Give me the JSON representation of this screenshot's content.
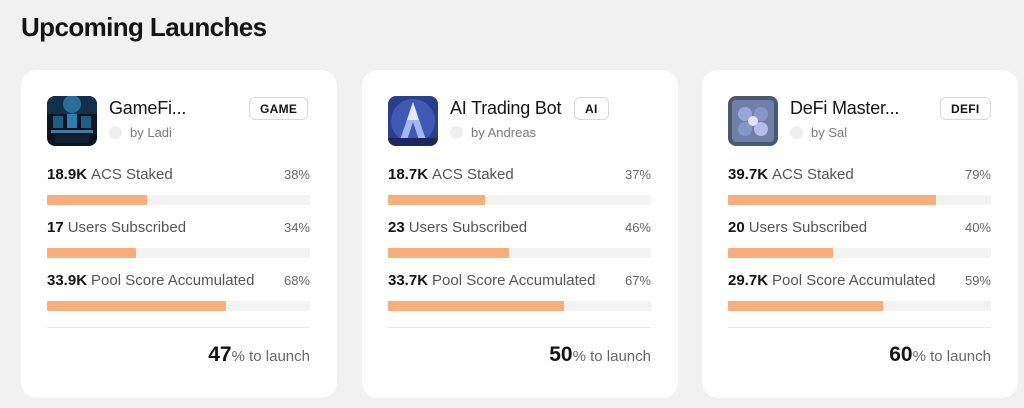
{
  "page_title": "Upcoming Launches",
  "colors": {
    "bar_fill": "#f7ae7a",
    "bar_track": "#f3f3f3",
    "card_bg": "#ffffff",
    "page_bg": "#f1f1f1"
  },
  "cards": [
    {
      "name": "GameFi...",
      "tag": "GAME",
      "author": "by Ladi",
      "thumb_icon": "gamefi-thumbnail-icon",
      "metrics": [
        {
          "value": "18.9K",
          "label": "ACS Staked",
          "percent_text": "38%",
          "percent": 38
        },
        {
          "value": "17",
          "label": "Users Subscribed",
          "percent_text": "34%",
          "percent": 34
        },
        {
          "value": "33.9K",
          "label": "Pool Score Accumulated",
          "percent_text": "68%",
          "percent": 68
        }
      ],
      "launch_value": "47",
      "launch_suffix": "% to launch"
    },
    {
      "name": "AI Trading Bot",
      "tag": "AI",
      "author": "by Andreas",
      "thumb_icon": "ai-trading-bot-thumbnail-icon",
      "metrics": [
        {
          "value": "18.7K",
          "label": "ACS Staked",
          "percent_text": "37%",
          "percent": 37
        },
        {
          "value": "23",
          "label": "Users Subscribed",
          "percent_text": "46%",
          "percent": 46
        },
        {
          "value": "33.7K",
          "label": "Pool Score Accumulated",
          "percent_text": "67%",
          "percent": 67
        }
      ],
      "launch_value": "50",
      "launch_suffix": "% to launch"
    },
    {
      "name": "DeFi Master...",
      "tag": "DEFI",
      "author": "by Sal",
      "thumb_icon": "defi-master-thumbnail-icon",
      "metrics": [
        {
          "value": "39.7K",
          "label": "ACS Staked",
          "percent_text": "79%",
          "percent": 79
        },
        {
          "value": "20",
          "label": "Users Subscribed",
          "percent_text": "40%",
          "percent": 40
        },
        {
          "value": "29.7K",
          "label": "Pool Score Accumulated",
          "percent_text": "59%",
          "percent": 59
        }
      ],
      "launch_value": "60",
      "launch_suffix": "% to launch"
    }
  ]
}
